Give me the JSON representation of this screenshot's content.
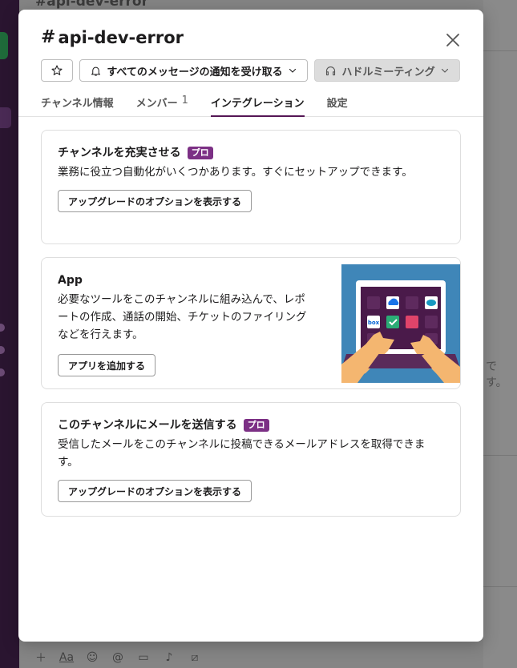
{
  "background": {
    "title": "#api-dev-error",
    "ghost_text": "です。"
  },
  "modal": {
    "title": "api-dev-error",
    "hash": "#",
    "header_buttons": {
      "notify_label": "すべてのメッセージの通知を受け取る",
      "huddle_label": "ハドルミーティング"
    },
    "tabs": [
      {
        "label": "チャンネル情報",
        "count": ""
      },
      {
        "label": "メンバー",
        "count": "1"
      },
      {
        "label": "インテグレーション",
        "count": ""
      },
      {
        "label": "設定",
        "count": ""
      }
    ],
    "active_tab": "インテグレーション"
  },
  "cards": {
    "enrich": {
      "title": "チャンネルを充実させる",
      "badge": "プロ",
      "description": "業務に役立つ自動化がいくつかあります。すぐにセットアップできます。",
      "button": "アップグレードのオプションを表示する"
    },
    "app": {
      "title": "App",
      "description": "必要なツールをこのチャンネルに組み込んで、レポートの作成、通話の開始、チケットのファイリングなどを行えます。",
      "button": "アプリを追加する",
      "illustration_labels": {
        "box": "box"
      }
    },
    "email": {
      "title": "このチャンネルにメールを送信する",
      "badge": "プロ",
      "description": "受信したメールをこのチャンネルに投稿できるメールアドレスを取得できます。",
      "button": "アップグレードのオプションを表示する"
    }
  },
  "colors": {
    "pro_badge": "#7c3085",
    "active_tab": "#541554",
    "illustration_bg": "#3f86b8"
  }
}
